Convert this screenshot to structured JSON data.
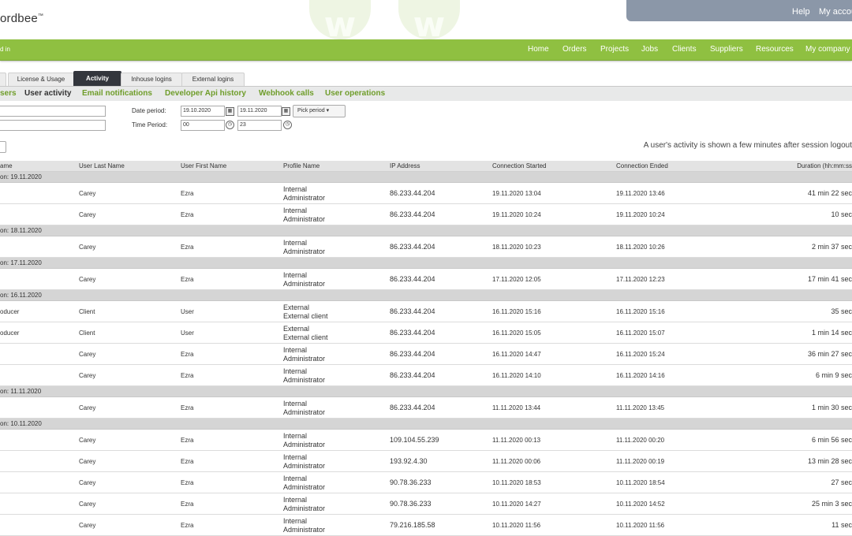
{
  "header": {
    "logo_text": "ordbee",
    "logo_tm": "™",
    "top_links": [
      "Help",
      "My accou"
    ]
  },
  "navbar": {
    "left_text": "d in",
    "items": [
      "Home",
      "Orders",
      "Projects",
      "Jobs",
      "Clients",
      "Suppliers",
      "Resources",
      "My company"
    ]
  },
  "tabs": {
    "items": [
      "License & Usage",
      "Activity",
      "Inhouse logins",
      "External logins"
    ],
    "active": "Activity"
  },
  "subtabs": {
    "items": [
      "sers",
      "User activity",
      "Email notifications",
      "Developer Api history",
      "Webhook calls",
      "User operations"
    ],
    "active": "User activity"
  },
  "filters": {
    "date_label": "Date period:",
    "date_from": "19.10.2020",
    "date_to": "19.11.2020",
    "pick_period": "Pick period",
    "time_label": "Time Period:",
    "time_from": "00",
    "time_to": "23"
  },
  "notice": "A user's activity is shown a few minutes after session logout",
  "columns": [
    "ame",
    "User Last Name",
    "User First Name",
    "Profile Name",
    "IP Address",
    "Connection Started",
    "Connection Ended",
    "Duration (hh:mm:ss"
  ],
  "groups": [
    {
      "label": "on: 19.11.2020",
      "rows": [
        {
          "first": "",
          "last": "Carey",
          "firstname": "Ezra",
          "profile1": "Internal",
          "profile2": "Administrator",
          "ip": "86.233.44.204",
          "started": "19.11.2020 13:04",
          "ended": "19.11.2020 13:46",
          "duration": "41 min 22 sec"
        },
        {
          "first": "",
          "last": "Carey",
          "firstname": "Ezra",
          "profile1": "Internal",
          "profile2": "Administrator",
          "ip": "86.233.44.204",
          "started": "19.11.2020 10:24",
          "ended": "19.11.2020 10:24",
          "duration": "10 sec"
        }
      ]
    },
    {
      "label": "on: 18.11.2020",
      "rows": [
        {
          "first": "",
          "last": "Carey",
          "firstname": "Ezra",
          "profile1": "Internal",
          "profile2": "Administrator",
          "ip": "86.233.44.204",
          "started": "18.11.2020 10:23",
          "ended": "18.11.2020 10:26",
          "duration": "2 min 37 sec"
        }
      ]
    },
    {
      "label": "on: 17.11.2020",
      "rows": [
        {
          "first": "",
          "last": "Carey",
          "firstname": "Ezra",
          "profile1": "Internal",
          "profile2": "Administrator",
          "ip": "86.233.44.204",
          "started": "17.11.2020 12:05",
          "ended": "17.11.2020 12:23",
          "duration": "17 min 41 sec"
        }
      ]
    },
    {
      "label": "on: 16.11.2020",
      "rows": [
        {
          "first": "oducer",
          "last": "Client",
          "firstname": "User",
          "profile1": "External",
          "profile2": "External client",
          "ip": "86.233.44.204",
          "started": "16.11.2020 15:16",
          "ended": "16.11.2020 15:16",
          "duration": "35 sec"
        },
        {
          "first": "oducer",
          "last": "Client",
          "firstname": "User",
          "profile1": "External",
          "profile2": "External client",
          "ip": "86.233.44.204",
          "started": "16.11.2020 15:05",
          "ended": "16.11.2020 15:07",
          "duration": "1 min 14 sec"
        },
        {
          "first": "",
          "last": "Carey",
          "firstname": "Ezra",
          "profile1": "Internal",
          "profile2": "Administrator",
          "ip": "86.233.44.204",
          "started": "16.11.2020 14:47",
          "ended": "16.11.2020 15:24",
          "duration": "36 min 27 sec"
        },
        {
          "first": "",
          "last": "Carey",
          "firstname": "Ezra",
          "profile1": "Internal",
          "profile2": "Administrator",
          "ip": "86.233.44.204",
          "started": "16.11.2020 14:10",
          "ended": "16.11.2020 14:16",
          "duration": "6 min 9 sec"
        }
      ]
    },
    {
      "label": "on: 11.11.2020",
      "rows": [
        {
          "first": "",
          "last": "Carey",
          "firstname": "Ezra",
          "profile1": "Internal",
          "profile2": "Administrator",
          "ip": "86.233.44.204",
          "started": "11.11.2020 13:44",
          "ended": "11.11.2020 13:45",
          "duration": "1 min 30 sec"
        }
      ]
    },
    {
      "label": "on: 10.11.2020",
      "rows": [
        {
          "first": "",
          "last": "Carey",
          "firstname": "Ezra",
          "profile1": "Internal",
          "profile2": "Administrator",
          "ip": "109.104.55.239",
          "started": "11.11.2020 00:13",
          "ended": "11.11.2020 00:20",
          "duration": "6 min 56 sec"
        },
        {
          "first": "",
          "last": "Carey",
          "firstname": "Ezra",
          "profile1": "Internal",
          "profile2": "Administrator",
          "ip": "193.92.4.30",
          "started": "11.11.2020 00:06",
          "ended": "11.11.2020 00:19",
          "duration": "13 min 28 sec"
        },
        {
          "first": "",
          "last": "Carey",
          "firstname": "Ezra",
          "profile1": "Internal",
          "profile2": "Administrator",
          "ip": "90.78.36.233",
          "started": "10.11.2020 18:53",
          "ended": "10.11.2020 18:54",
          "duration": "27 sec"
        },
        {
          "first": "",
          "last": "Carey",
          "firstname": "Ezra",
          "profile1": "Internal",
          "profile2": "Administrator",
          "ip": "90.78.36.233",
          "started": "10.11.2020 14:27",
          "ended": "10.11.2020 14:52",
          "duration": "25 min 3 sec"
        },
        {
          "first": "",
          "last": "Carey",
          "firstname": "Ezra",
          "profile1": "Internal",
          "profile2": "Administrator",
          "ip": "79.216.185.58",
          "started": "10.11.2020 11:56",
          "ended": "10.11.2020 11:56",
          "duration": "11 sec"
        }
      ]
    }
  ]
}
